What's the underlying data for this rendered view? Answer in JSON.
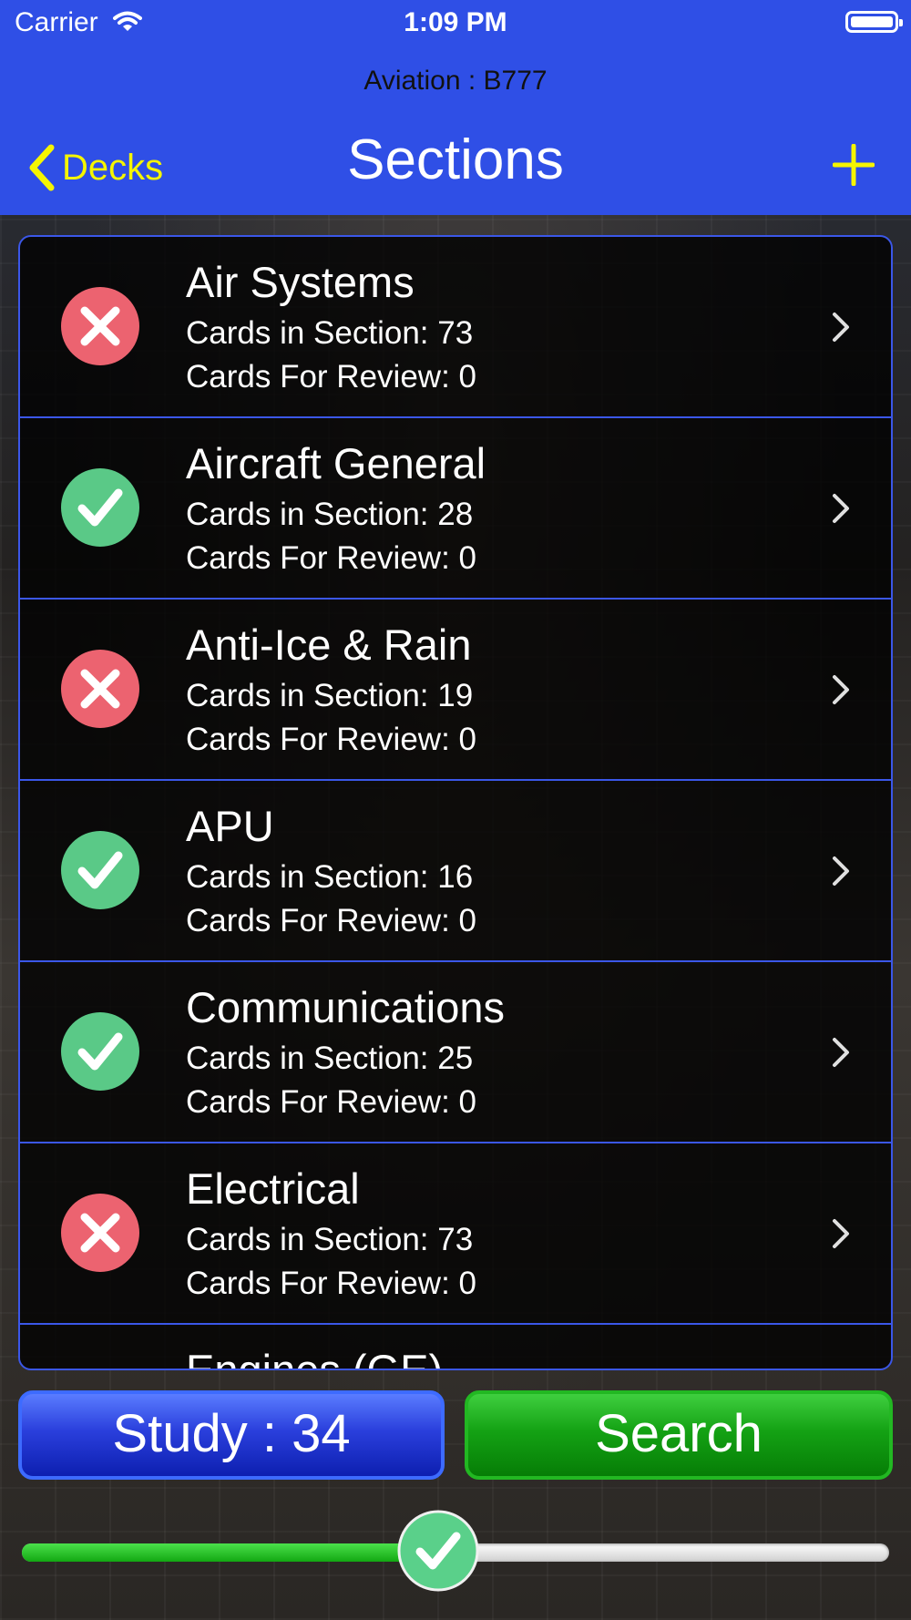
{
  "status_bar": {
    "carrier": "Carrier",
    "time": "1:09 PM"
  },
  "header": {
    "deck_name": "Aviation : B777",
    "title": "Sections",
    "back_label": "Decks",
    "accent_color": "#f5f500",
    "bar_color": "#2f4fe6"
  },
  "sections": [
    {
      "title": "Air Systems",
      "cards": "Cards in Section: 73",
      "review": "Cards For Review: 0",
      "status": "incorrect",
      "icon": "x-circle-icon"
    },
    {
      "title": "Aircraft General",
      "cards": "Cards in Section: 28",
      "review": "Cards For Review: 0",
      "status": "correct",
      "icon": "check-circle-icon"
    },
    {
      "title": "Anti-Ice & Rain",
      "cards": "Cards in Section: 19",
      "review": "Cards For Review: 0",
      "status": "incorrect",
      "icon": "x-circle-icon"
    },
    {
      "title": "APU",
      "cards": "Cards in Section: 16",
      "review": "Cards For Review: 0",
      "status": "correct",
      "icon": "check-circle-icon"
    },
    {
      "title": "Communications",
      "cards": "Cards in Section: 25",
      "review": "Cards For Review: 0",
      "status": "correct",
      "icon": "check-circle-icon"
    },
    {
      "title": "Electrical",
      "cards": "Cards in Section: 73",
      "review": "Cards For Review: 0",
      "status": "incorrect",
      "icon": "x-circle-icon"
    },
    {
      "title": "Engines (GE)",
      "cards": "",
      "review": "",
      "status": "unknown",
      "icon": ""
    }
  ],
  "buttons": {
    "study": "Study : 34",
    "search": "Search"
  },
  "slider": {
    "value_fraction": 0.48,
    "thumb_icon": "check-circle-icon"
  }
}
